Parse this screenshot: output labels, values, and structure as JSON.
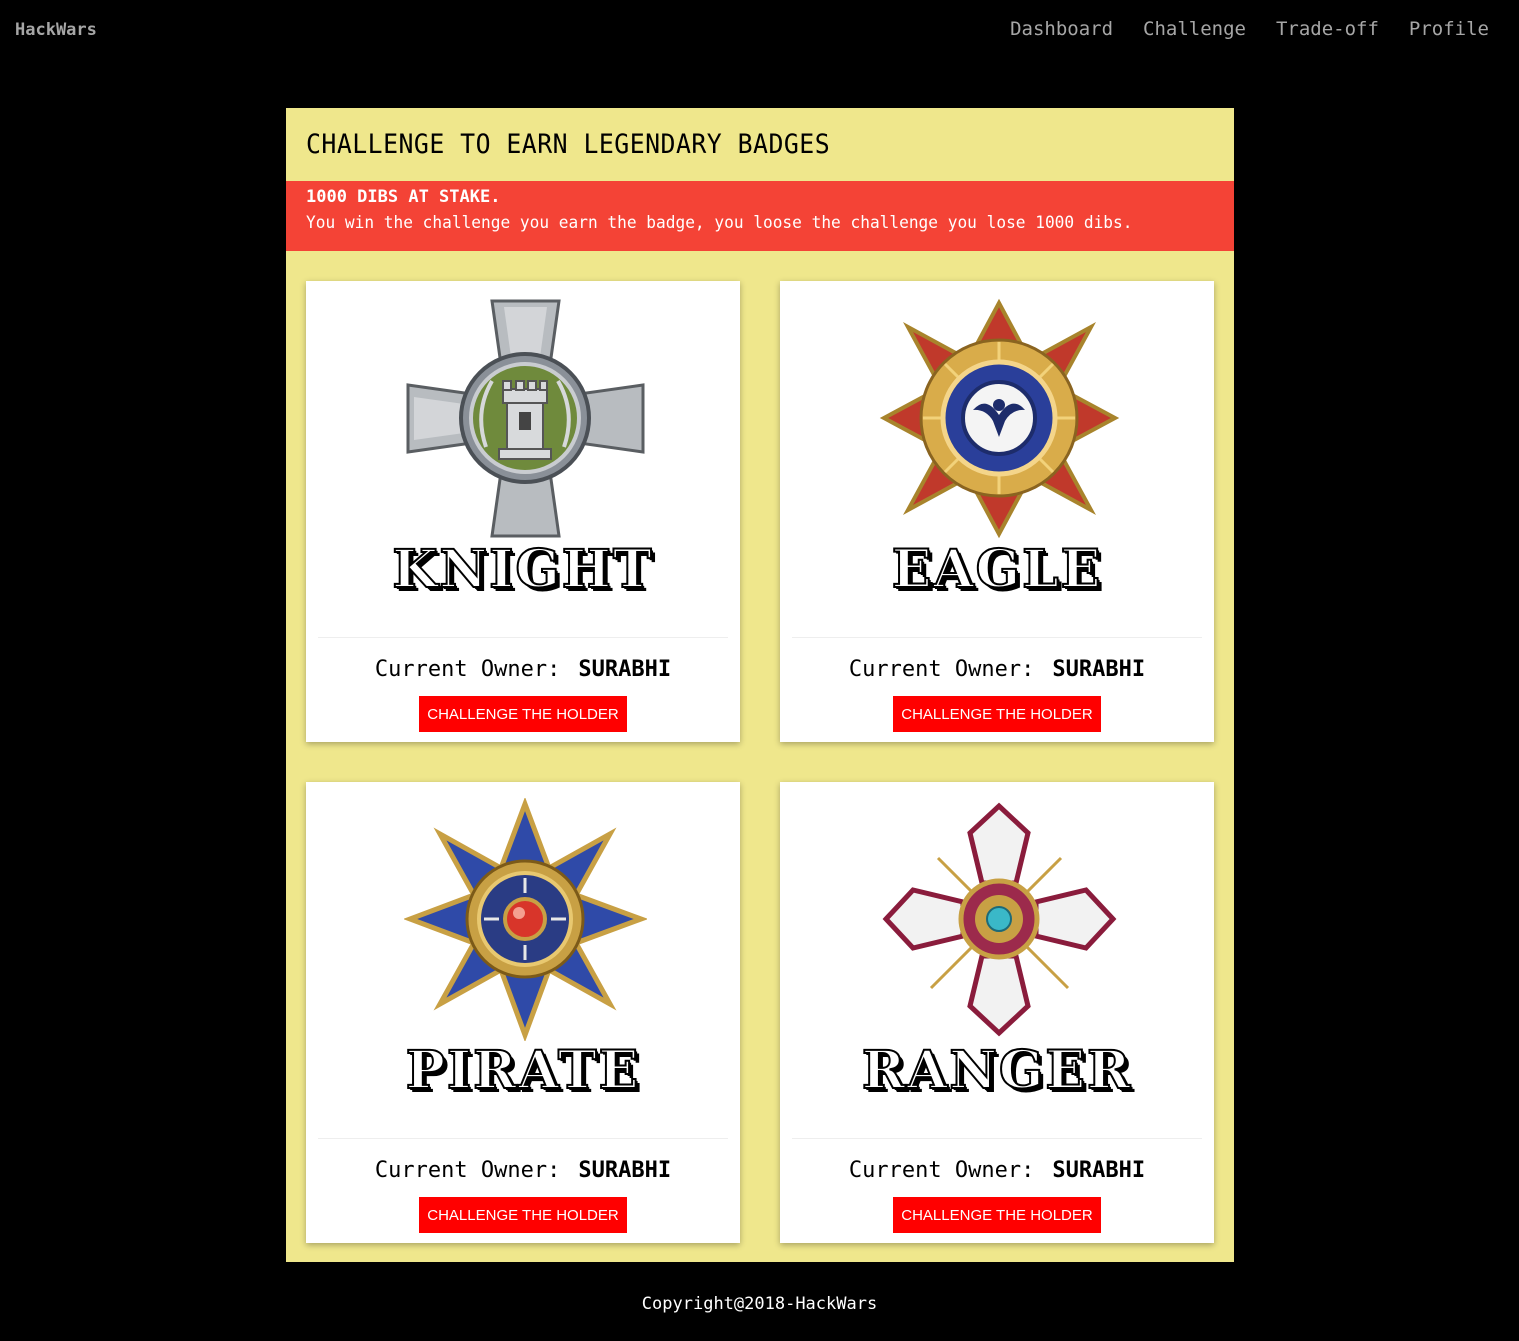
{
  "navbar": {
    "brand": "HackWars",
    "links": [
      {
        "label": "Dashboard"
      },
      {
        "label": "Challenge"
      },
      {
        "label": "Trade-off"
      },
      {
        "label": "Profile"
      }
    ]
  },
  "panel": {
    "title": "CHALLENGE TO EARN LEGENDARY BADGES",
    "alert": {
      "heading": "1000 DIBS AT STAKE.",
      "text": "You win the challenge you earn the badge, you loose the challenge you lose 1000 dibs."
    }
  },
  "badges": [
    {
      "name": "KNIGHT",
      "owner_label": "Current Owner:",
      "owner": "SURABHI",
      "button": "CHALLENGE THE HOLDER",
      "icon": "knight-badge-icon"
    },
    {
      "name": "EAGLE",
      "owner_label": "Current Owner:",
      "owner": "SURABHI",
      "button": "CHALLENGE THE HOLDER",
      "icon": "eagle-badge-icon"
    },
    {
      "name": "PIRATE",
      "owner_label": "Current Owner:",
      "owner": "SURABHI",
      "button": "CHALLENGE THE HOLDER",
      "icon": "pirate-badge-icon"
    },
    {
      "name": "RANGER",
      "owner_label": "Current Owner:",
      "owner": "SURABHI",
      "button": "CHALLENGE THE HOLDER",
      "icon": "ranger-badge-icon"
    }
  ],
  "footer": {
    "copyright": "Copyright@2018-HackWars"
  },
  "colors": {
    "background": "#000000",
    "panel": "#efe78c",
    "alert": "#f44336",
    "button": "#ff0000",
    "nav_text": "#a6a6a6"
  }
}
